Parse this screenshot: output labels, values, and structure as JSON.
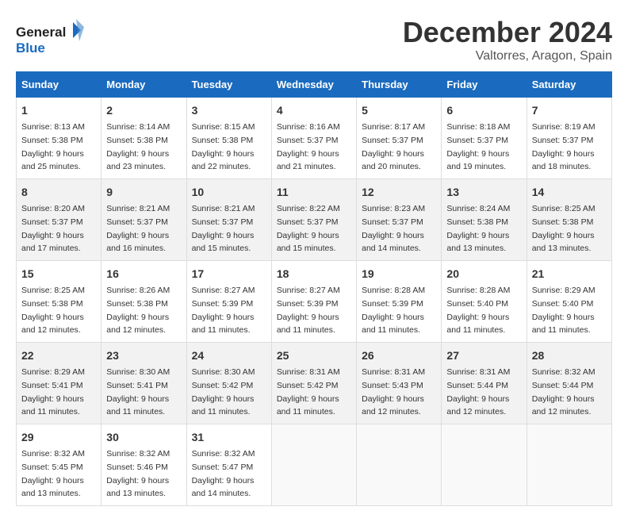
{
  "logo": {
    "line1": "General",
    "line2": "Blue"
  },
  "title": "December 2024",
  "location": "Valtorres, Aragon, Spain",
  "days_of_week": [
    "Sunday",
    "Monday",
    "Tuesday",
    "Wednesday",
    "Thursday",
    "Friday",
    "Saturday"
  ],
  "weeks": [
    [
      {
        "day": "1",
        "sunrise": "8:13 AM",
        "sunset": "5:38 PM",
        "daylight": "9 hours and 25 minutes."
      },
      {
        "day": "2",
        "sunrise": "8:14 AM",
        "sunset": "5:38 PM",
        "daylight": "9 hours and 23 minutes."
      },
      {
        "day": "3",
        "sunrise": "8:15 AM",
        "sunset": "5:38 PM",
        "daylight": "9 hours and 22 minutes."
      },
      {
        "day": "4",
        "sunrise": "8:16 AM",
        "sunset": "5:37 PM",
        "daylight": "9 hours and 21 minutes."
      },
      {
        "day": "5",
        "sunrise": "8:17 AM",
        "sunset": "5:37 PM",
        "daylight": "9 hours and 20 minutes."
      },
      {
        "day": "6",
        "sunrise": "8:18 AM",
        "sunset": "5:37 PM",
        "daylight": "9 hours and 19 minutes."
      },
      {
        "day": "7",
        "sunrise": "8:19 AM",
        "sunset": "5:37 PM",
        "daylight": "9 hours and 18 minutes."
      }
    ],
    [
      {
        "day": "8",
        "sunrise": "8:20 AM",
        "sunset": "5:37 PM",
        "daylight": "9 hours and 17 minutes."
      },
      {
        "day": "9",
        "sunrise": "8:21 AM",
        "sunset": "5:37 PM",
        "daylight": "9 hours and 16 minutes."
      },
      {
        "day": "10",
        "sunrise": "8:21 AM",
        "sunset": "5:37 PM",
        "daylight": "9 hours and 15 minutes."
      },
      {
        "day": "11",
        "sunrise": "8:22 AM",
        "sunset": "5:37 PM",
        "daylight": "9 hours and 15 minutes."
      },
      {
        "day": "12",
        "sunrise": "8:23 AM",
        "sunset": "5:37 PM",
        "daylight": "9 hours and 14 minutes."
      },
      {
        "day": "13",
        "sunrise": "8:24 AM",
        "sunset": "5:38 PM",
        "daylight": "9 hours and 13 minutes."
      },
      {
        "day": "14",
        "sunrise": "8:25 AM",
        "sunset": "5:38 PM",
        "daylight": "9 hours and 13 minutes."
      }
    ],
    [
      {
        "day": "15",
        "sunrise": "8:25 AM",
        "sunset": "5:38 PM",
        "daylight": "9 hours and 12 minutes."
      },
      {
        "day": "16",
        "sunrise": "8:26 AM",
        "sunset": "5:38 PM",
        "daylight": "9 hours and 12 minutes."
      },
      {
        "day": "17",
        "sunrise": "8:27 AM",
        "sunset": "5:39 PM",
        "daylight": "9 hours and 11 minutes."
      },
      {
        "day": "18",
        "sunrise": "8:27 AM",
        "sunset": "5:39 PM",
        "daylight": "9 hours and 11 minutes."
      },
      {
        "day": "19",
        "sunrise": "8:28 AM",
        "sunset": "5:39 PM",
        "daylight": "9 hours and 11 minutes."
      },
      {
        "day": "20",
        "sunrise": "8:28 AM",
        "sunset": "5:40 PM",
        "daylight": "9 hours and 11 minutes."
      },
      {
        "day": "21",
        "sunrise": "8:29 AM",
        "sunset": "5:40 PM",
        "daylight": "9 hours and 11 minutes."
      }
    ],
    [
      {
        "day": "22",
        "sunrise": "8:29 AM",
        "sunset": "5:41 PM",
        "daylight": "9 hours and 11 minutes."
      },
      {
        "day": "23",
        "sunrise": "8:30 AM",
        "sunset": "5:41 PM",
        "daylight": "9 hours and 11 minutes."
      },
      {
        "day": "24",
        "sunrise": "8:30 AM",
        "sunset": "5:42 PM",
        "daylight": "9 hours and 11 minutes."
      },
      {
        "day": "25",
        "sunrise": "8:31 AM",
        "sunset": "5:42 PM",
        "daylight": "9 hours and 11 minutes."
      },
      {
        "day": "26",
        "sunrise": "8:31 AM",
        "sunset": "5:43 PM",
        "daylight": "9 hours and 12 minutes."
      },
      {
        "day": "27",
        "sunrise": "8:31 AM",
        "sunset": "5:44 PM",
        "daylight": "9 hours and 12 minutes."
      },
      {
        "day": "28",
        "sunrise": "8:32 AM",
        "sunset": "5:44 PM",
        "daylight": "9 hours and 12 minutes."
      }
    ],
    [
      {
        "day": "29",
        "sunrise": "8:32 AM",
        "sunset": "5:45 PM",
        "daylight": "9 hours and 13 minutes."
      },
      {
        "day": "30",
        "sunrise": "8:32 AM",
        "sunset": "5:46 PM",
        "daylight": "9 hours and 13 minutes."
      },
      {
        "day": "31",
        "sunrise": "8:32 AM",
        "sunset": "5:47 PM",
        "daylight": "9 hours and 14 minutes."
      },
      null,
      null,
      null,
      null
    ]
  ]
}
